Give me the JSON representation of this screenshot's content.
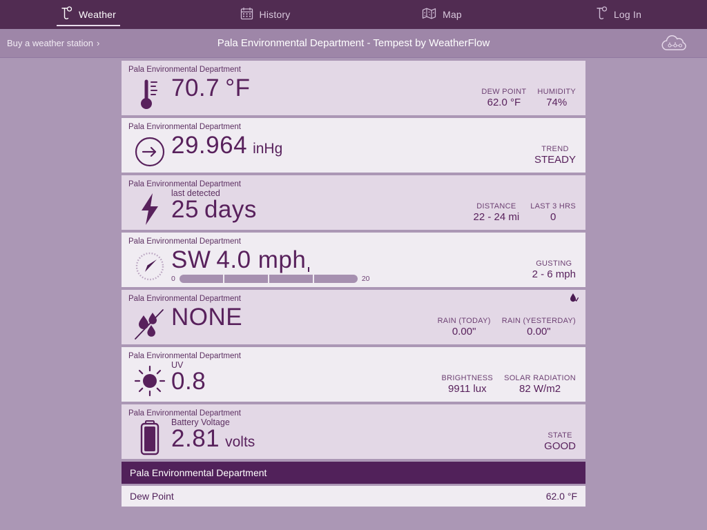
{
  "nav": {
    "items": [
      {
        "label": "Weather",
        "icon": "tempest-logo-icon",
        "active": true
      },
      {
        "label": "History",
        "icon": "calendar-icon",
        "active": false
      },
      {
        "label": "Map",
        "icon": "map-icon",
        "active": false
      },
      {
        "label": "Log In",
        "icon": "tempest-logo-icon",
        "active": false
      }
    ]
  },
  "subheader": {
    "buy_label": "Buy a weather station",
    "buy_chevron": "›",
    "station_title": "Pala Environmental Department - Tempest by WeatherFlow",
    "brand_icon": "weatherflow-cloud-logo"
  },
  "station_name": "Pala Environmental Department",
  "cards": [
    {
      "id": "temperature",
      "icon": "thermometer-icon",
      "station": "Pala Environmental Department",
      "sublabel": "",
      "value": "70.7",
      "unit": "°F",
      "stats": [
        {
          "label": "DEW POINT",
          "value": "62.0 °F"
        },
        {
          "label": "HUMIDITY",
          "value": "74%"
        }
      ]
    },
    {
      "id": "pressure",
      "icon": "pressure-arrow-icon",
      "station": "Pala Environmental Department",
      "sublabel": "",
      "value": "29.964",
      "unit": "inHg",
      "stats": [
        {
          "label": "TREND",
          "value": "STEADY"
        }
      ]
    },
    {
      "id": "lightning",
      "icon": "lightning-bolt-icon",
      "station": "Pala Environmental Department",
      "sublabel": "last detected",
      "value": "25",
      "unit": "days",
      "stats": [
        {
          "label": "DISTANCE",
          "value": "22 - 24 mi"
        },
        {
          "label": "LAST 3 HRS",
          "value": "0"
        }
      ]
    },
    {
      "id": "wind",
      "icon": "wind-compass-icon",
      "station": "Pala Environmental Department",
      "sublabel": "",
      "value": "SW",
      "unit": "4.0 mph",
      "gauge": {
        "min": "0",
        "max": "20",
        "segments": 4
      },
      "stats": [
        {
          "label": "GUSTING",
          "value": "2 - 6 mph"
        }
      ]
    },
    {
      "id": "rain",
      "icon": "raindrops-icon",
      "station": "Pala Environmental Department",
      "sublabel": "",
      "value": "NONE",
      "unit": "",
      "corner_icon": "rain-check-icon",
      "stats": [
        {
          "label": "RAIN (TODAY)",
          "value": "0.00\""
        },
        {
          "label": "RAIN (YESTERDAY)",
          "value": "0.00\""
        }
      ]
    },
    {
      "id": "uv",
      "icon": "sun-icon",
      "station": "Pala Environmental Department",
      "sublabel": "UV",
      "value": "0.8",
      "unit": "",
      "stats": [
        {
          "label": "BRIGHTNESS",
          "value": "9911 lux"
        },
        {
          "label": "SOLAR RADIATION",
          "value": "82 W/m2"
        }
      ]
    },
    {
      "id": "battery",
      "icon": "battery-icon",
      "station": "Pala Environmental Department",
      "sublabel": "Battery Voltage",
      "value": "2.81",
      "unit": "volts",
      "stats": [
        {
          "label": "STATE",
          "value": "GOOD"
        }
      ]
    }
  ],
  "table": {
    "header": "Pala Environmental Department",
    "rows": [
      {
        "label": "Dew Point",
        "value": "62.0 °F"
      }
    ]
  },
  "colors": {
    "nav_bg": "#512c52",
    "subheader_bg": "#9e86a8",
    "page_bg": "#ab97b5",
    "card_shade_a": "#e3d8e6",
    "card_shade_b": "#f0ecf2",
    "accent": "#58215c"
  }
}
